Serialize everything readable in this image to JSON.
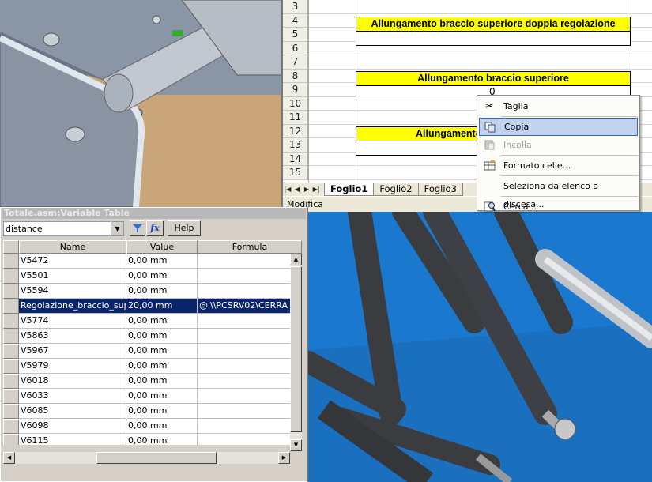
{
  "excel": {
    "rows": [
      "3",
      "4",
      "5",
      "6",
      "7",
      "8",
      "9",
      "10",
      "11",
      "12",
      "13",
      "14",
      "15"
    ],
    "title_boxes": [
      "Allungamento braccio superiore doppia regolazione",
      "Allungamento braccio superiore",
      "Allungamento"
    ],
    "cell_value_r9": "0",
    "sheet_tabs": [
      "Foglio1",
      "Foglio2",
      "Foglio3"
    ],
    "status": "Modifica"
  },
  "context_menu": {
    "items": [
      {
        "label": "Taglia",
        "icon": "scissors-icon",
        "enabled": true
      },
      {
        "label": "Copia",
        "icon": "copy-icon",
        "enabled": true,
        "highlighted": true
      },
      {
        "label": "Incolla",
        "icon": "paste-icon",
        "enabled": false
      },
      {
        "label": "Formato celle...",
        "icon": "format-cells-icon",
        "enabled": true
      },
      {
        "label": "Seleziona da elenco a discesa...",
        "enabled": true
      },
      {
        "label": "Cerca...",
        "icon": "search-icon",
        "enabled": true
      }
    ]
  },
  "variable_table": {
    "title": "Totale.asm:Variable Table",
    "filter_value": "distance",
    "help_label": "Help",
    "columns": [
      "Name",
      "Value",
      "Formula"
    ],
    "rows": [
      {
        "name": "V5472",
        "value": "0,00 mm",
        "formula": ""
      },
      {
        "name": "V5501",
        "value": "0,00 mm",
        "formula": ""
      },
      {
        "name": "V5594",
        "value": "0,00 mm",
        "formula": ""
      },
      {
        "name": "Regolazione_braccio_supe",
        "value": "20,00 mm",
        "formula": "@'\\\\PCSRV02\\CERRA",
        "selected": true
      },
      {
        "name": "V5774",
        "value": "0,00 mm",
        "formula": ""
      },
      {
        "name": "V5863",
        "value": "0,00 mm",
        "formula": ""
      },
      {
        "name": "V5967",
        "value": "0,00 mm",
        "formula": ""
      },
      {
        "name": "V5979",
        "value": "0,00 mm",
        "formula": ""
      },
      {
        "name": "V6018",
        "value": "0,00 mm",
        "formula": ""
      },
      {
        "name": "V6033",
        "value": "0,00 mm",
        "formula": ""
      },
      {
        "name": "V6085",
        "value": "0,00 mm",
        "formula": ""
      },
      {
        "name": "V6098",
        "value": "0,00 mm",
        "formula": ""
      },
      {
        "name": "V6115",
        "value": "0,00 mm",
        "formula": ""
      }
    ]
  }
}
